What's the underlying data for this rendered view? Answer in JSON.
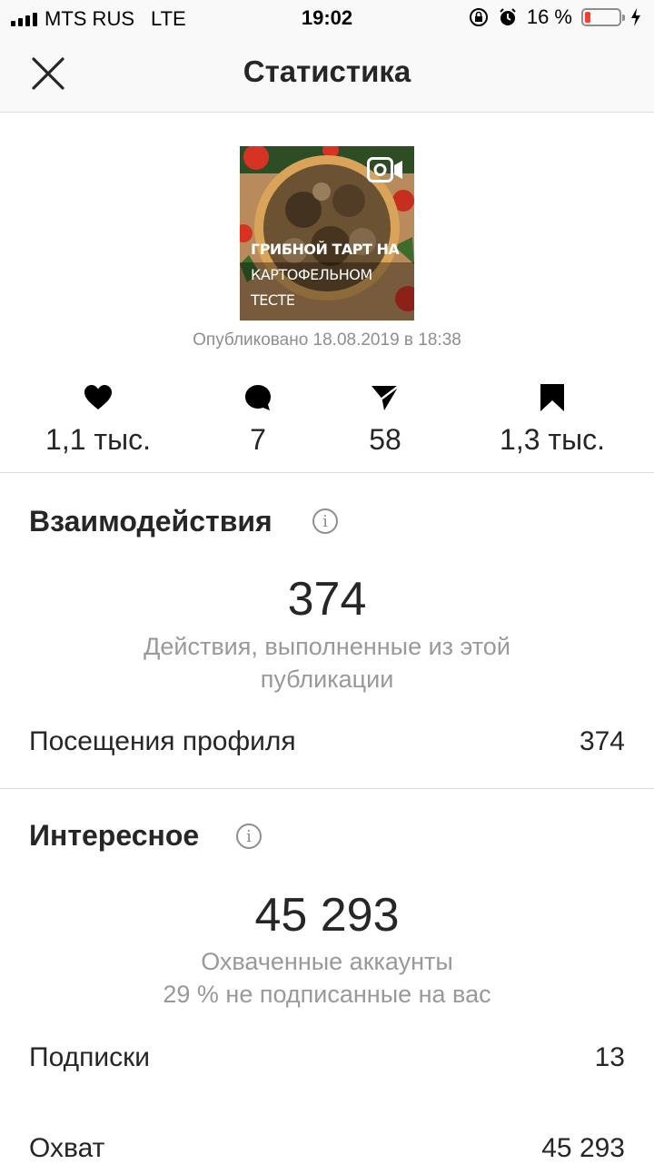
{
  "status_bar": {
    "carrier": "MTS RUS",
    "network": "LTE",
    "time": "19:02",
    "battery_percent": "16 %",
    "battery_level": 0.16,
    "battery_color": "#ff3b30"
  },
  "header": {
    "title": "Статистика",
    "close_icon": "close-icon"
  },
  "post": {
    "thumbnail_caption_line1": "ГРИБНОЙ ТАРТ НА",
    "thumbnail_caption_line2": "КАРТОФЕЛЬНОМ ТЕСТЕ",
    "media_type_icon": "video-camera-icon",
    "published": "Опубликовано 18.08.2019 в 18:38"
  },
  "metrics": [
    {
      "icon": "heart-icon",
      "value": "1,1 тыс."
    },
    {
      "icon": "comment-icon",
      "value": "7"
    },
    {
      "icon": "send-icon",
      "value": "58"
    },
    {
      "icon": "bookmark-icon",
      "value": "1,3 тыс."
    }
  ],
  "interactions": {
    "title": "Взаимодействия",
    "info_icon": "info-icon",
    "total": "374",
    "description_line1": "Действия, выполненные из этой",
    "description_line2": "публикации",
    "rows": [
      {
        "label": "Посещения профиля",
        "value": "374"
      }
    ]
  },
  "discovery": {
    "title": "Интересное",
    "info_icon": "info-icon",
    "total": "45 293",
    "description_line1": "Охваченные аккаунты",
    "description_line2": "29 % не подписанные на вас",
    "rows": [
      {
        "label": "Подписки",
        "value": "13"
      },
      {
        "label": "Охват",
        "value": "45 293"
      }
    ]
  }
}
